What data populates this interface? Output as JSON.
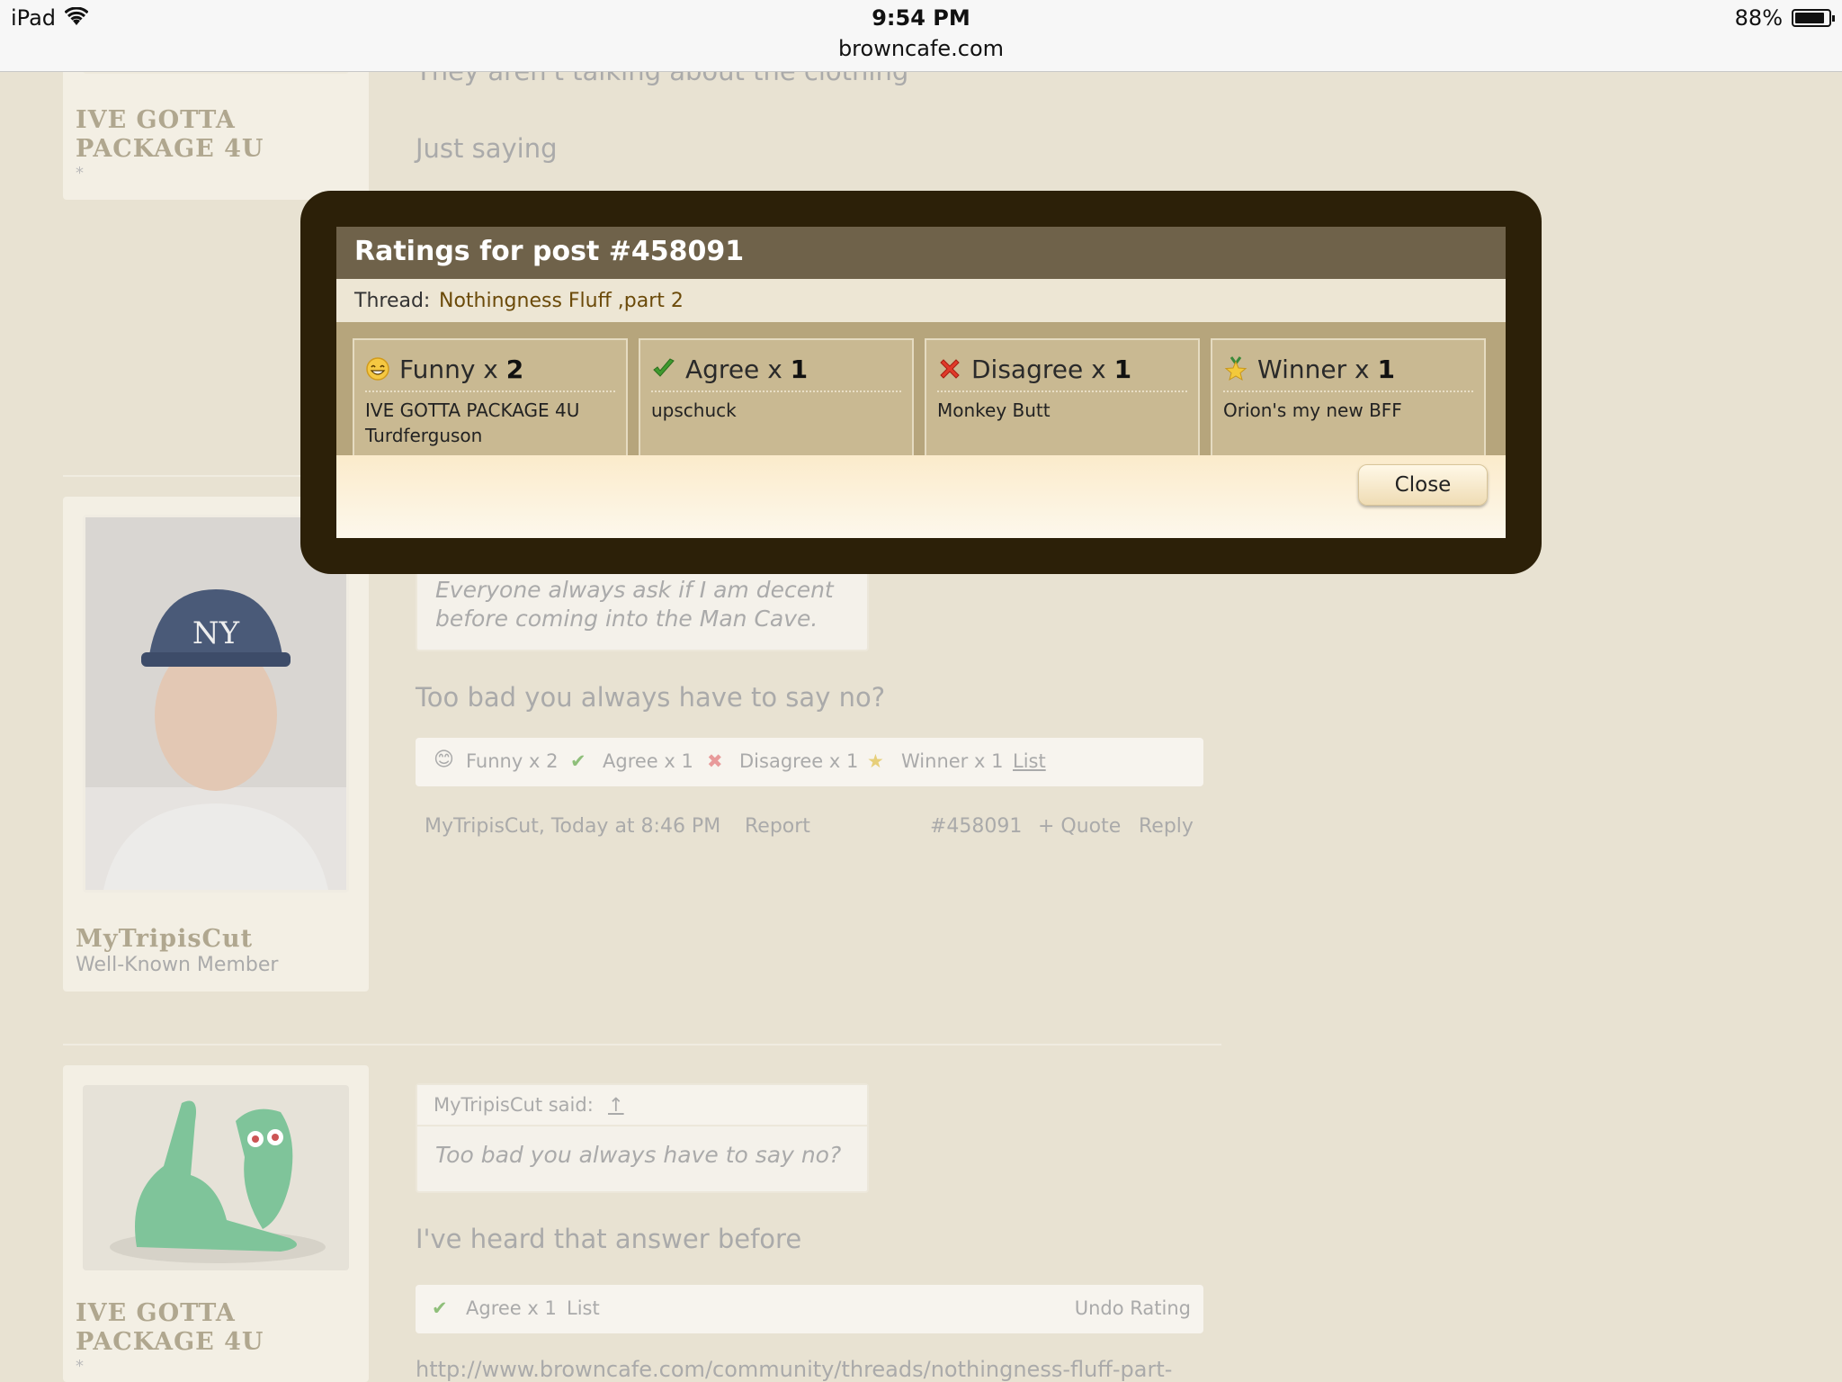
{
  "status_bar": {
    "device": "iPad",
    "time": "9:54 PM",
    "url": "browncafe.com",
    "battery": "88%",
    "battery_level": 0.88
  },
  "posts": [
    {
      "user_name": "IVE GOTTA PACKAGE 4U",
      "user_star": "*",
      "message_top": "They aren't talking about the clothing",
      "message": "Just saying"
    },
    {
      "user_name": "MyTripisCut",
      "user_title": "Well-Known Member",
      "quote_text": "Everyone always ask if I am decent before coming into the Man Cave.",
      "message": "Too bad you always have to say no?",
      "ratings": [
        {
          "label": "Funny",
          "count": "x 2"
        },
        {
          "label": "Agree",
          "count": "x 1"
        },
        {
          "label": "Disagree",
          "count": "x 1"
        },
        {
          "label": "Winner",
          "count": "x 1"
        }
      ],
      "list_link": "List",
      "author_time": "MyTripisCut, Today at 8:46 PM",
      "report": "Report",
      "post_number": "#458091",
      "quote_link": "+ Quote",
      "reply_link": "Reply"
    },
    {
      "user_name": "IVE GOTTA PACKAGE 4U",
      "user_star": "*",
      "quote_author": "MyTripisCut said:",
      "quote_arrow": "↑",
      "quote_text": "Too bad you always have to say no?",
      "message": "I've heard that answer before",
      "rating_agree": "Agree",
      "rating_agree_count": "x 1",
      "list_link": "List",
      "undo_rating": "Undo Rating",
      "link_text": "http://www.browncafe.com/community/threads/nothingness-fluff-part-"
    }
  ],
  "modal": {
    "title": "Ratings for post #458091",
    "thread_label": "Thread:",
    "thread_title": "Nothingness Fluff ,part 2",
    "ratings": [
      {
        "name": "Funny",
        "x": "x",
        "count": "2",
        "icon": "smiley-icon",
        "users": [
          "IVE GOTTA PACKAGE 4U",
          "Turdferguson"
        ]
      },
      {
        "name": "Agree",
        "x": "x",
        "count": "1",
        "icon": "checkmark-icon",
        "users": [
          "upschuck"
        ]
      },
      {
        "name": "Disagree",
        "x": "x",
        "count": "1",
        "icon": "red-x-icon",
        "users": [
          "Monkey Butt"
        ]
      },
      {
        "name": "Winner",
        "x": "x",
        "count": "1",
        "icon": "winner-star-icon",
        "users": [
          "Orion's my new BFF"
        ]
      }
    ],
    "close_label": "Close"
  },
  "colors": {
    "modal_frame": "#2c2008",
    "modal_title_bar": "#6f624a",
    "ratings_area": "#b6a57c",
    "rating_card": "#c9b992",
    "thread_link": "#6b4a09"
  }
}
